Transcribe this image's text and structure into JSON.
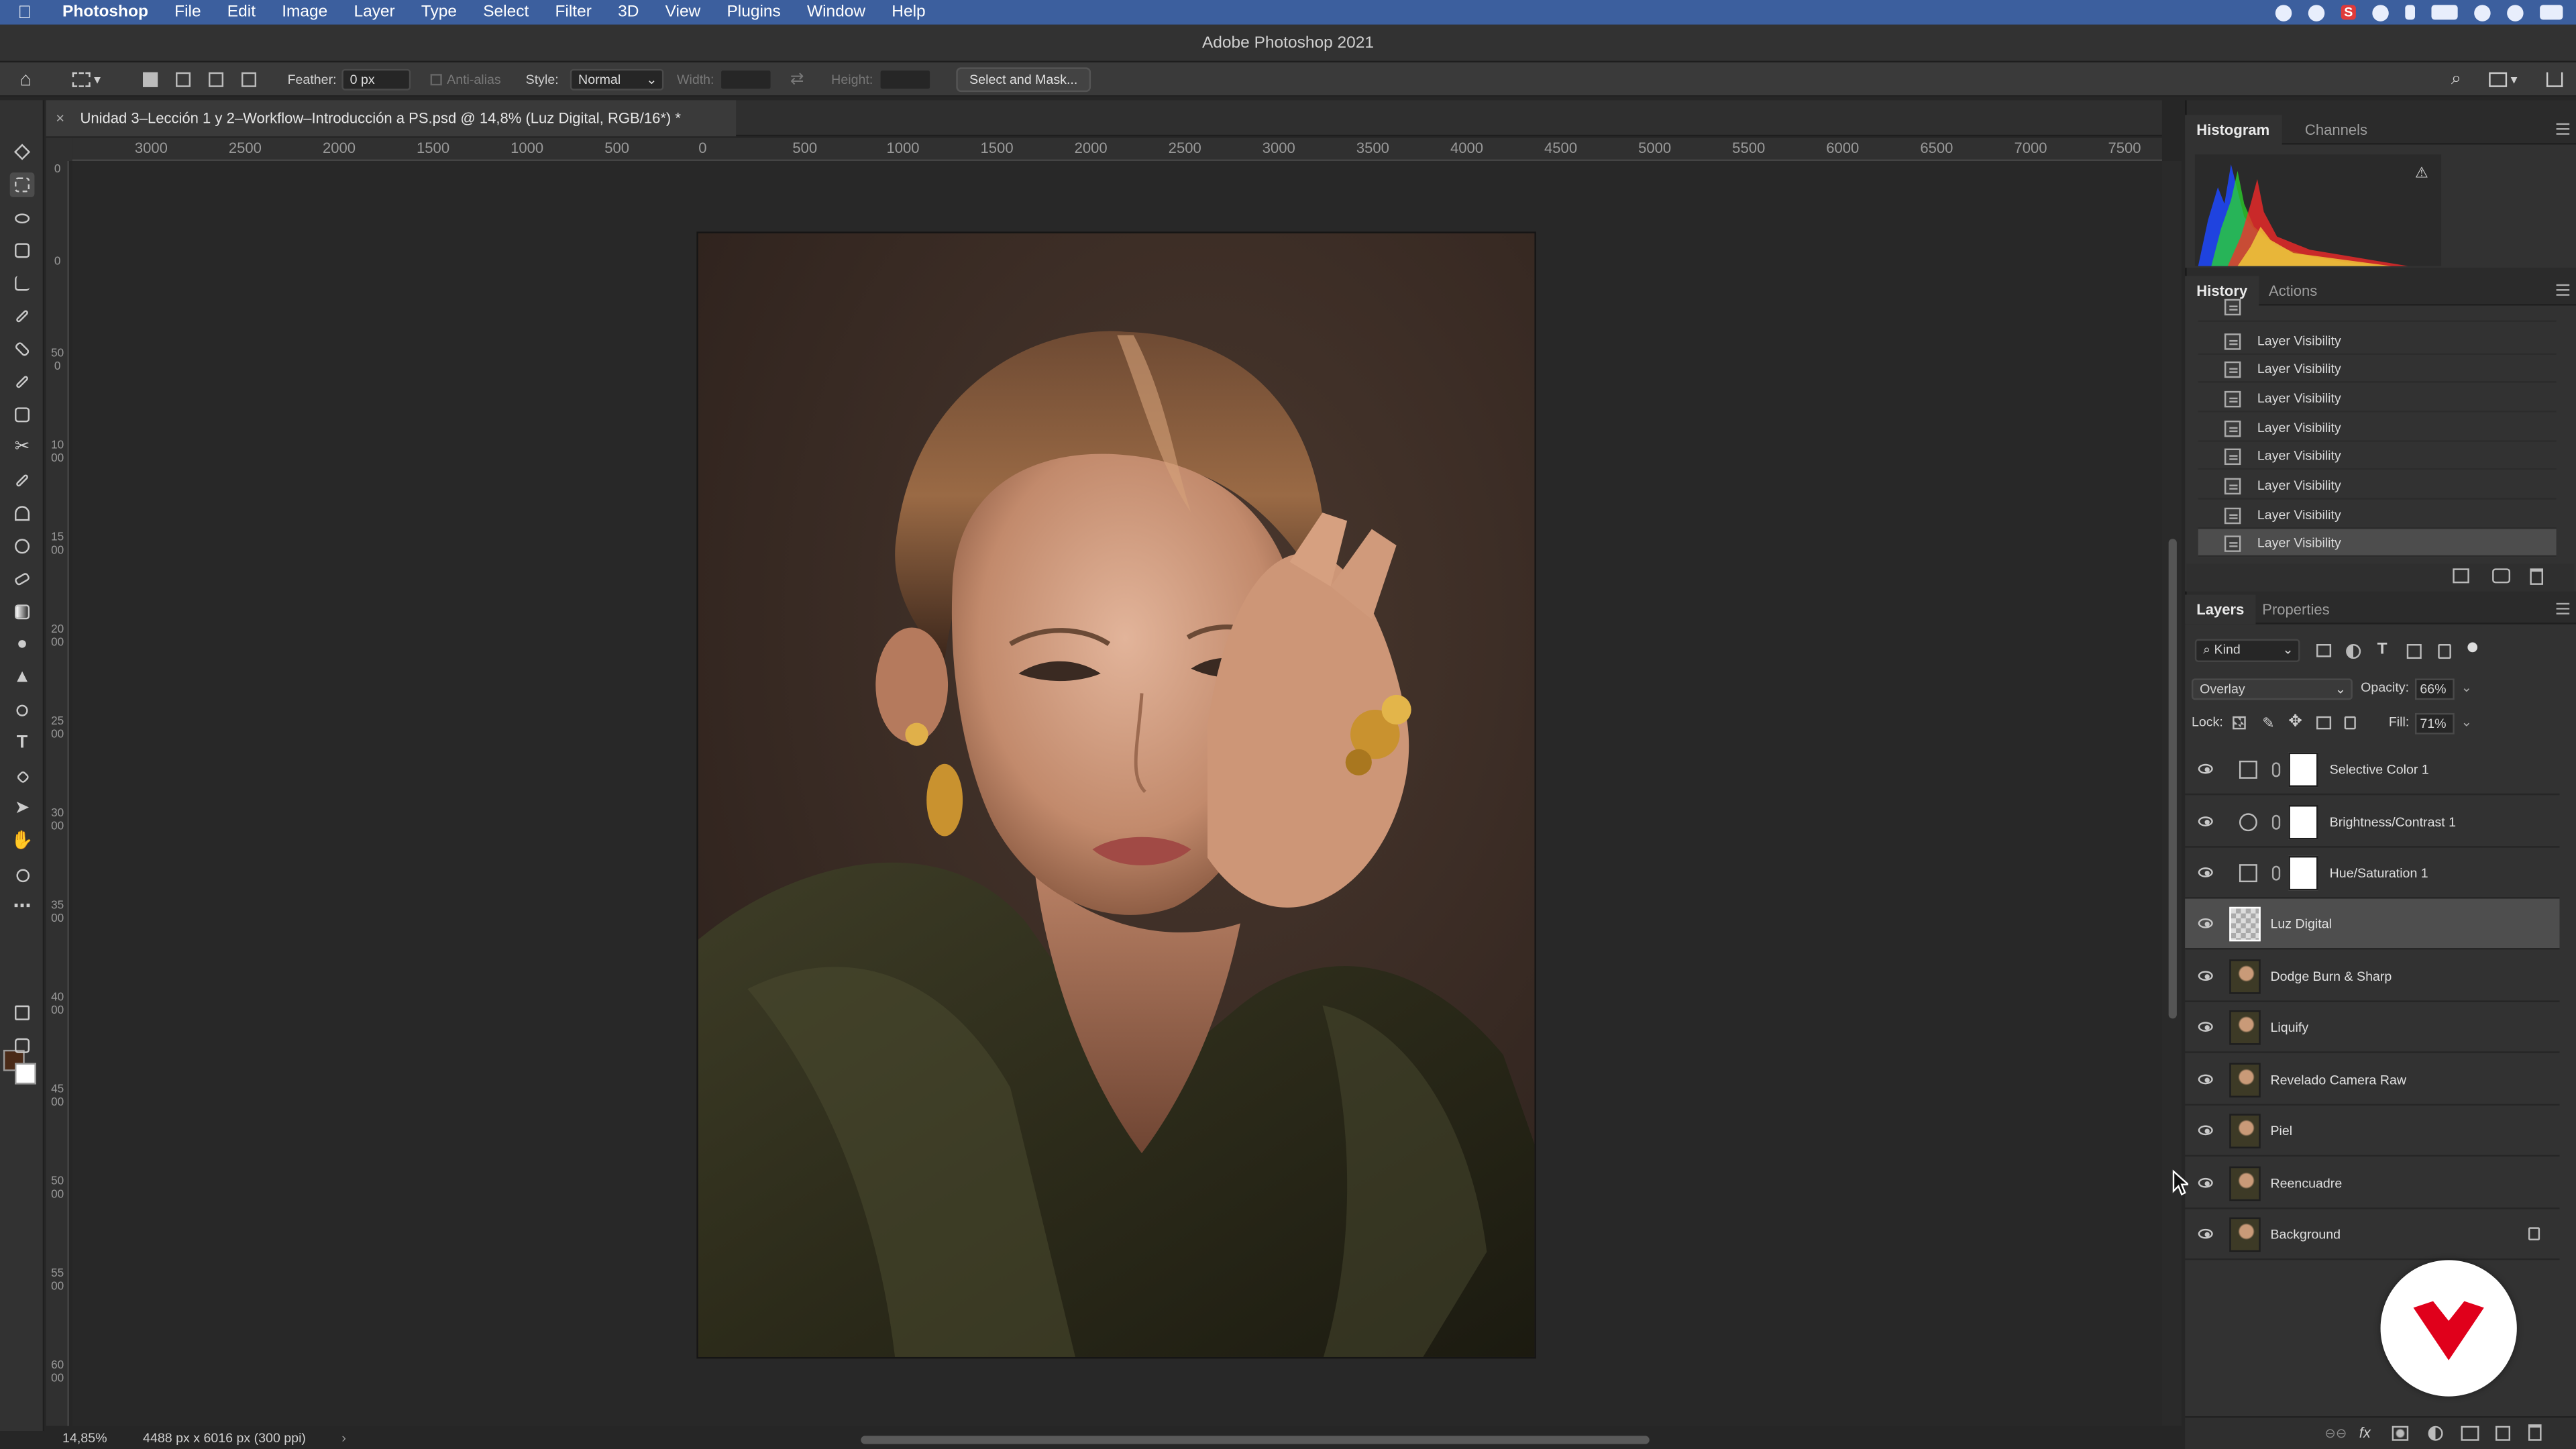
{
  "menubar": {
    "app": "Photoshop",
    "items": [
      "File",
      "Edit",
      "Image",
      "Layer",
      "Type",
      "Select",
      "Filter",
      "3D",
      "View",
      "Plugins",
      "Window",
      "Help"
    ]
  },
  "window": {
    "title": "Adobe Photoshop 2021"
  },
  "options": {
    "feather_label": "Feather:",
    "feather_value": "0 px",
    "antialias_label": "Anti-alias",
    "style_label": "Style:",
    "style_value": "Normal",
    "width_label": "Width:",
    "height_label": "Height:",
    "select_mask_label": "Select and Mask..."
  },
  "document": {
    "tab_title": "Unidad 3–Lección 1 y 2–Workflow–Introducción a PS.psd @ 14,8% (Luz Digital, RGB/16*) *",
    "zoom": "14,85%",
    "info": "4488 px x 6016 px (300 ppi)"
  },
  "ruler": {
    "h_labels": [
      "3000",
      "2500",
      "2000",
      "1500",
      "1000",
      "500",
      "0",
      "500",
      "1000",
      "1500",
      "2000",
      "2500",
      "3000",
      "3500",
      "4000",
      "4500",
      "5000",
      "5500",
      "6000",
      "6500",
      "7000",
      "7500"
    ],
    "v_labels": [
      "0",
      "0",
      "500",
      "1000",
      "1500",
      "2000",
      "2500",
      "3000",
      "3500",
      "4000",
      "4500",
      "5000",
      "5500",
      "6000"
    ]
  },
  "panels": {
    "histogram_tabs": [
      "Histogram",
      "Channels"
    ],
    "history_tabs": [
      "History",
      "Actions"
    ],
    "history_items": [
      "Layer Visibility",
      "Layer Visibility",
      "Layer Visibility",
      "Layer Visibility",
      "Layer Visibility",
      "Layer Visibility",
      "Layer Visibility",
      "Layer Visibility"
    ],
    "layers_tabs": [
      "Layers",
      "Properties"
    ],
    "kind_label": "Kind",
    "blend_mode": "Overlay",
    "opacity_label": "Opacity:",
    "opacity_value": "66%",
    "lock_label": "Lock:",
    "fill_label": "Fill:",
    "fill_value": "71%",
    "layers": [
      {
        "name": "Selective Color 1",
        "type": "adjustment"
      },
      {
        "name": "Brightness/Contrast 1",
        "type": "adjustment"
      },
      {
        "name": "Hue/Saturation 1",
        "type": "adjustment"
      },
      {
        "name": "Luz Digital",
        "type": "pixel-empty",
        "selected": true
      },
      {
        "name": "Dodge Burn & Sharp",
        "type": "pixel"
      },
      {
        "name": "Liquify",
        "type": "pixel"
      },
      {
        "name": "Revelado Camera Raw",
        "type": "pixel"
      },
      {
        "name": "Piel",
        "type": "pixel"
      },
      {
        "name": "Reencuadre",
        "type": "pixel"
      },
      {
        "name": "Background",
        "type": "pixel",
        "locked": true
      }
    ]
  },
  "colors": {
    "menubar": "#3c5f9e",
    "foreground": "#4a2a17",
    "background": "#ffffff",
    "brand": "#e0001b"
  }
}
